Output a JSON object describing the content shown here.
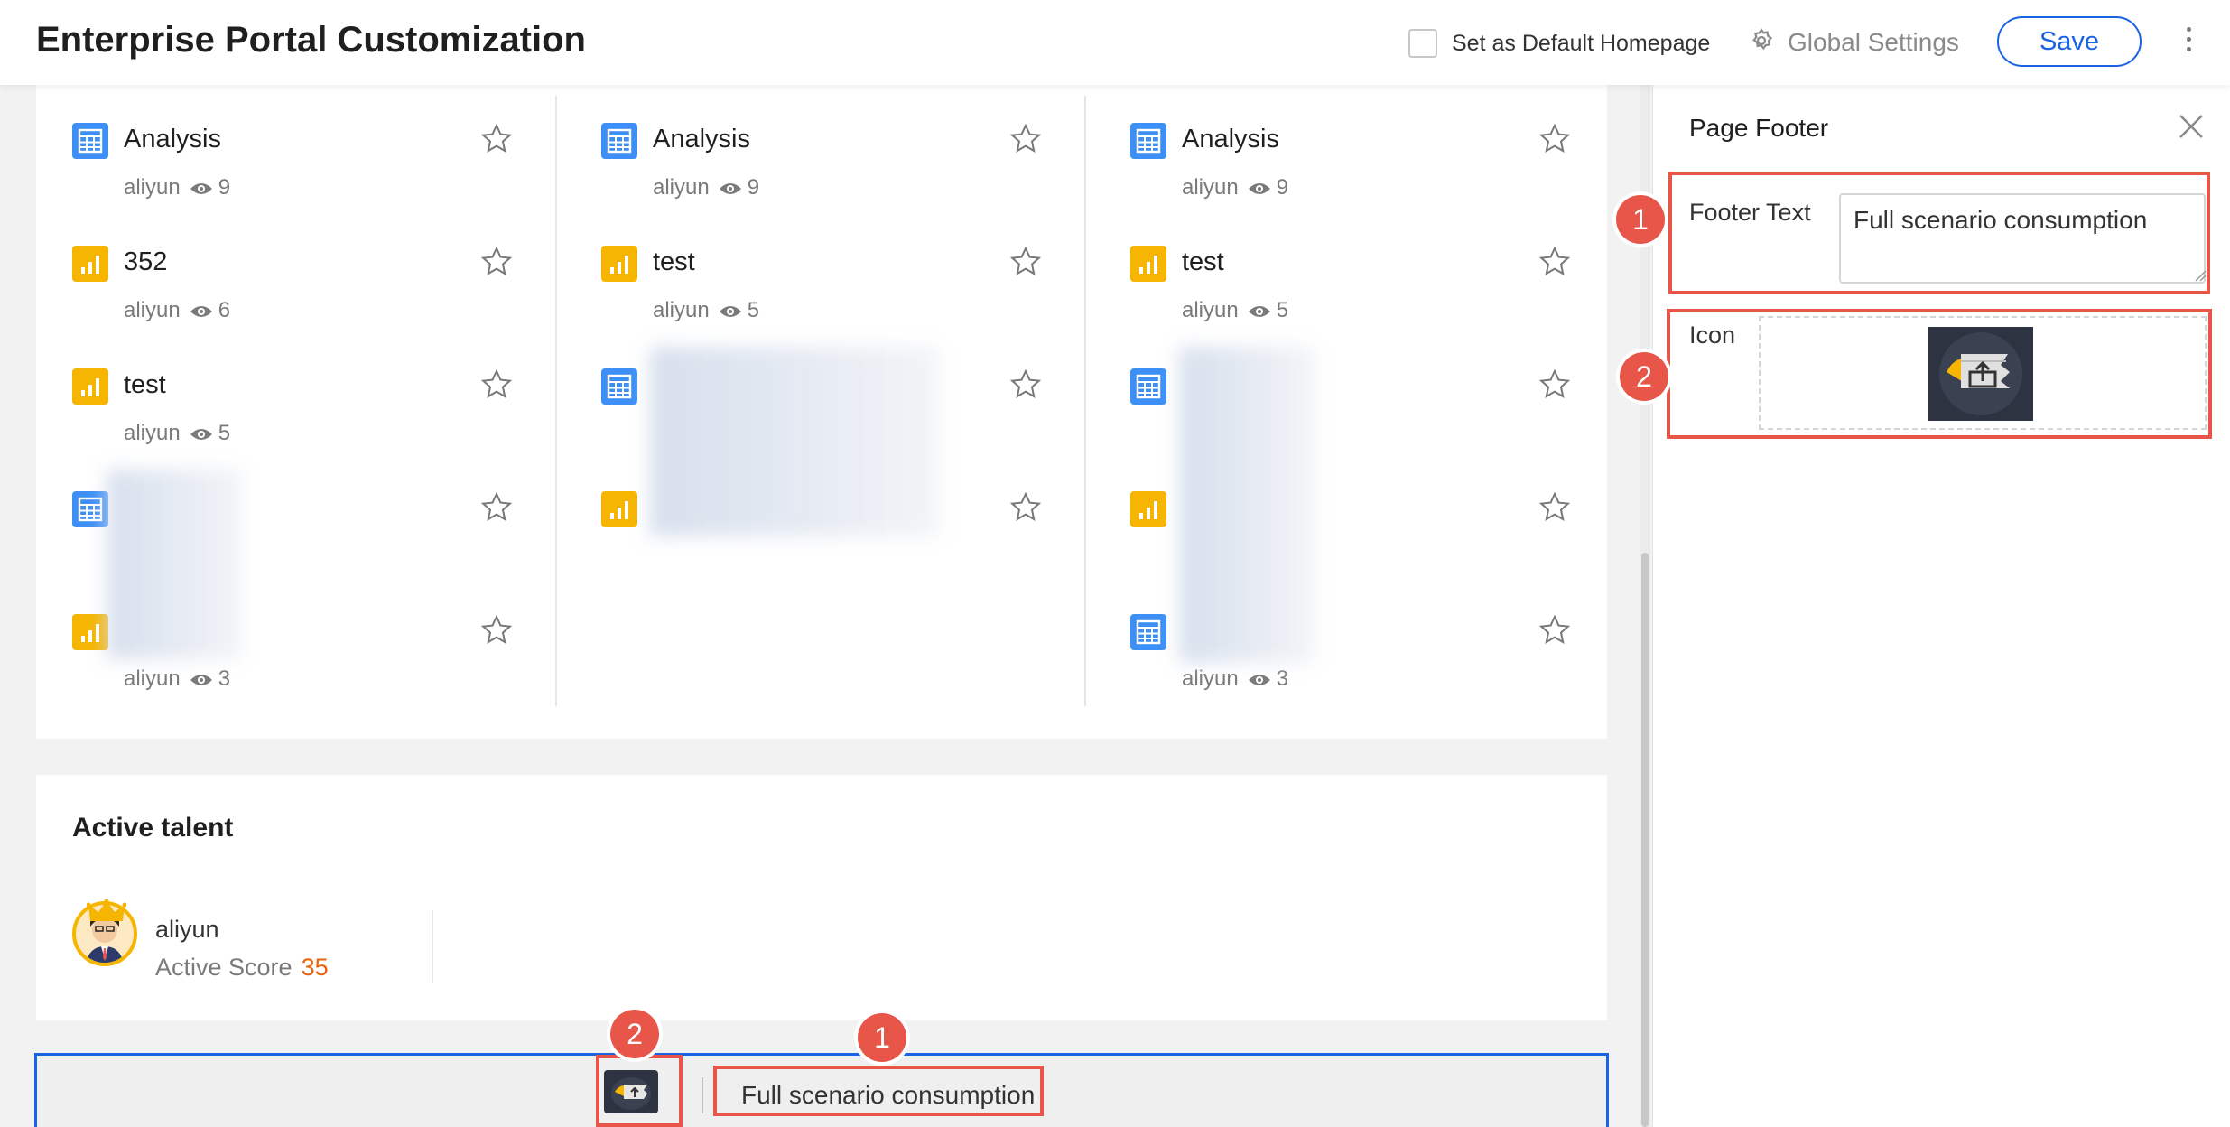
{
  "header": {
    "title": "Enterprise Portal Customization",
    "default_homepage_label": "Set as Default Homepage",
    "global_settings_label": "Global Settings",
    "save_label": "Save"
  },
  "columns": [
    [
      {
        "type": "table",
        "name": "Analysis",
        "owner": "aliyun",
        "views": "9"
      },
      {
        "type": "chart",
        "name": "352",
        "owner": "aliyun",
        "views": "6"
      },
      {
        "type": "chart",
        "name": "test",
        "owner": "aliyun",
        "views": "5"
      },
      {
        "type": "table",
        "name": "",
        "owner": "",
        "views": ""
      },
      {
        "type": "chart",
        "name": "",
        "owner": "aliyun",
        "views": "3"
      }
    ],
    [
      {
        "type": "table",
        "name": "Analysis",
        "owner": "aliyun",
        "views": "9"
      },
      {
        "type": "chart",
        "name": "test",
        "owner": "aliyun",
        "views": "5"
      },
      {
        "type": "table",
        "name": "",
        "owner": "",
        "views": ""
      },
      {
        "type": "chart",
        "name": "",
        "owner": "",
        "views": ""
      }
    ],
    [
      {
        "type": "table",
        "name": "Analysis",
        "owner": "aliyun",
        "views": "9"
      },
      {
        "type": "chart",
        "name": "test",
        "owner": "aliyun",
        "views": "5"
      },
      {
        "type": "table",
        "name": "",
        "owner": "",
        "views": ""
      },
      {
        "type": "chart",
        "name": "",
        "owner": "",
        "views": ""
      },
      {
        "type": "table",
        "name": "",
        "owner": "aliyun",
        "views": "3"
      }
    ]
  ],
  "active_talent": {
    "title": "Active talent",
    "user": "aliyun",
    "score_label": "Active Score",
    "score": "35"
  },
  "footer_preview": {
    "text": "Full scenario consumption",
    "badge_text": "1",
    "badge_icon": "2"
  },
  "panel": {
    "title": "Page Footer",
    "footer_text_label": "Footer Text",
    "footer_text_value": "Full scenario consumption",
    "icon_label": "Icon",
    "badge_text": "1",
    "badge_icon": "2"
  },
  "colors": {
    "accent": "#1a64e3",
    "highlight": "#e8564a",
    "table_icon": "#3d8ff5",
    "chart_icon": "#f6b500",
    "score": "#e8630a"
  }
}
